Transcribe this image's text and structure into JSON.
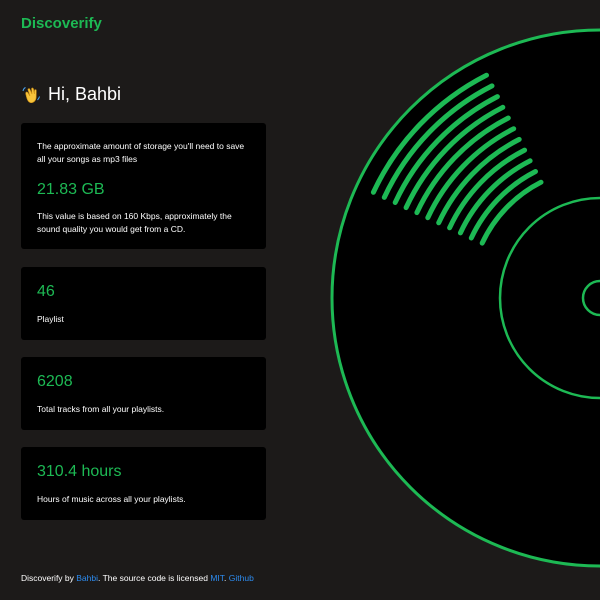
{
  "app": {
    "brand": "Discoverify"
  },
  "greeting": {
    "emoji_icon": "waving-hand-icon",
    "text": "Hi, Bahbi"
  },
  "cards": {
    "storage": {
      "description": "The approximate amount of storage you'll need to save all your songs as mp3 files",
      "value": "21.83 GB",
      "note": "This value is based on 160 Kbps, approximately the sound quality you would get from a CD."
    },
    "playlists": {
      "value": "46",
      "label": "Playlist"
    },
    "tracks": {
      "value": "6208",
      "label": "Total tracks from all your playlists."
    },
    "hours": {
      "value": "310.4 hours",
      "label": "Hours of music across all your playlists."
    }
  },
  "footer": {
    "prefix": "Discoverify by ",
    "author_link": "Bahbi",
    "middle": ". The source code is licensed ",
    "license_link": "MIT",
    "separator": ". ",
    "github_link": "Github"
  },
  "colors": {
    "background": "#1c1a19",
    "card_background": "#000000",
    "accent_green": "#1db954",
    "link_blue": "#2d8cf0",
    "text": "#ffffff"
  }
}
